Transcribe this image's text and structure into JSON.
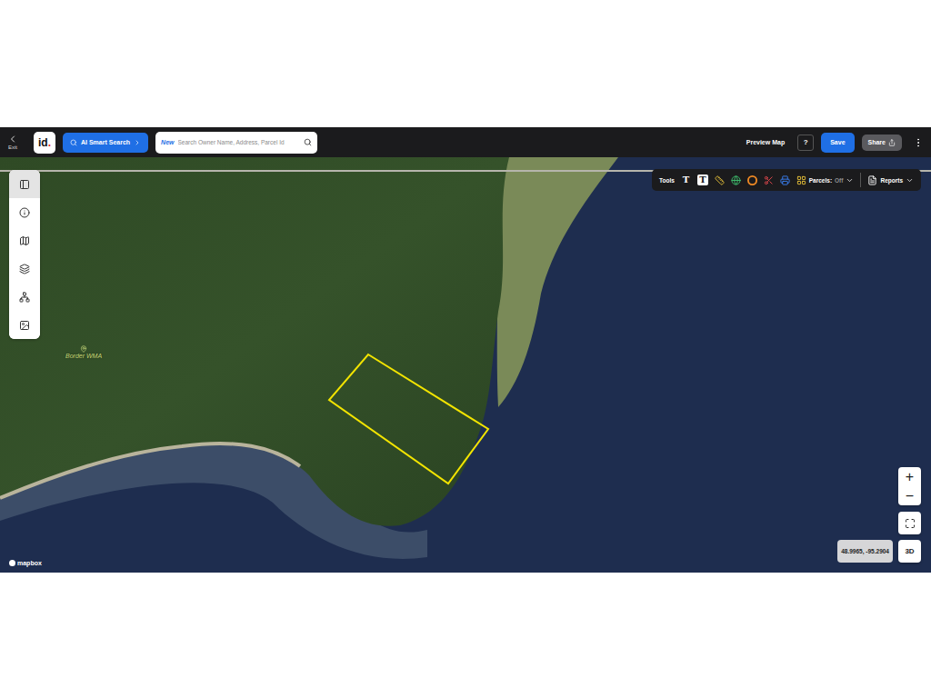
{
  "header": {
    "exit": "Exit",
    "logo": {
      "text": "id",
      "mark": "."
    },
    "ai_search": "AI Smart Search",
    "search": {
      "badge": "New",
      "placeholder": "Search Owner Name, Address, Parcel Id"
    },
    "preview": "Preview Map",
    "help": "?",
    "save": "Save",
    "share": "Share"
  },
  "toolbar": {
    "label": "Tools",
    "text_tools": [
      "T",
      "T"
    ],
    "parcels": {
      "label": "Parcels:",
      "value": "Off"
    },
    "reports": "Reports"
  },
  "sidebar": {
    "items": [
      {
        "selected": true
      },
      {
        "selected": false
      },
      {
        "selected": false
      },
      {
        "selected": false
      },
      {
        "selected": false
      },
      {
        "selected": false
      }
    ]
  },
  "map": {
    "place_label": "Border WMA",
    "attribution": "mapbox",
    "coordinates": "48.9965, -95.2904",
    "zoom_in": "+",
    "zoom_out": "−",
    "view_3d": "3D"
  }
}
